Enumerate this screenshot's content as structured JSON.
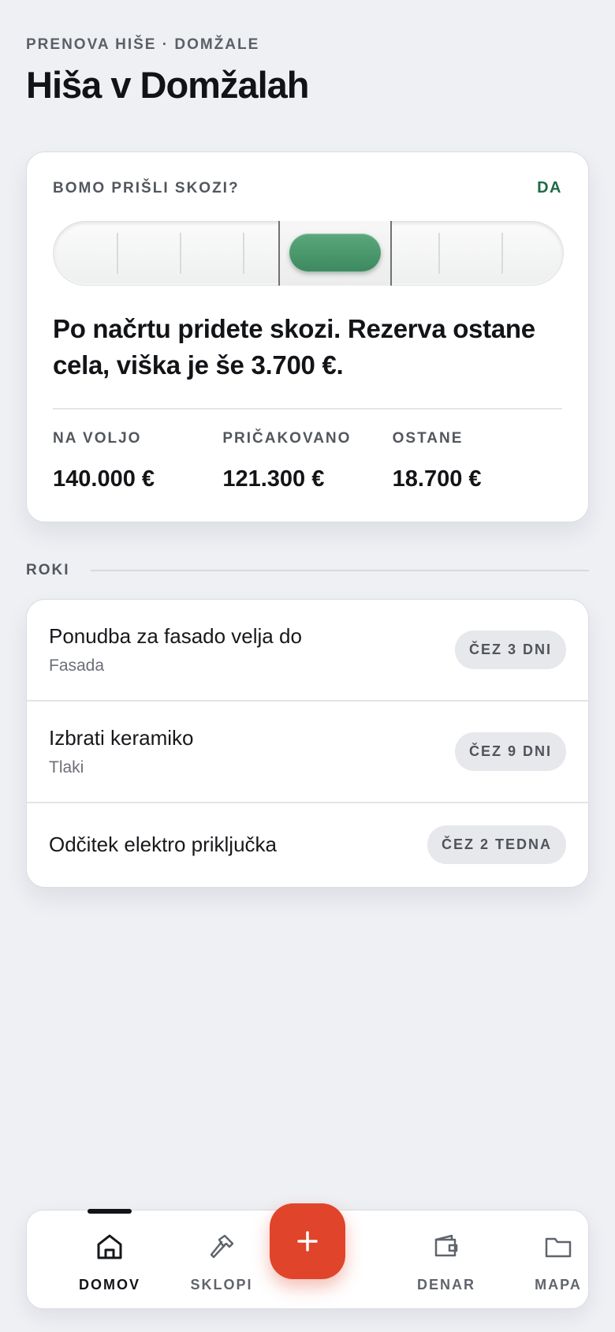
{
  "header": {
    "eyebrow": "PRENOVA HIŠE · DOMŽALE",
    "title": "Hiša v Domžalah"
  },
  "status_card": {
    "question": "BOMO PRIŠLI SKOZI?",
    "answer": "DA",
    "answer_color": "#1f6a44",
    "meter_state": "positive",
    "meter_color": "#4a9a6d",
    "verdict": "Po načrtu pridete skozi. Rezerva ostane cela, viška je še 3.700 €.",
    "stats": [
      {
        "label": "NA VOLJO",
        "value": "140.000 €"
      },
      {
        "label": "PRIČAKOVANO",
        "value": "121.300 €"
      },
      {
        "label": "OSTANE",
        "value": "18.700 €"
      }
    ]
  },
  "deadlines": {
    "section_title": "ROKI",
    "items": [
      {
        "title": "Ponudba za fasado velja do",
        "subtitle": "Fasada",
        "badge": "ČEZ 3 DNI"
      },
      {
        "title": "Izbrati keramiko",
        "subtitle": "Tlaki",
        "badge": "ČEZ 9 DNI"
      },
      {
        "title": "Odčitek elektro priključka",
        "subtitle": "",
        "badge": "ČEZ 2 TEDNA"
      }
    ]
  },
  "tabbar": {
    "tabs": [
      {
        "label": "DOMOV",
        "icon": "home-icon",
        "active": true
      },
      {
        "label": "SKLOPI",
        "icon": "hammer-icon",
        "active": false
      },
      {
        "label": "DENAR",
        "icon": "wallet-icon",
        "active": false
      },
      {
        "label": "MAPA",
        "icon": "folder-icon",
        "active": false
      }
    ],
    "fab_icon": "plus-icon",
    "fab_color": "#e0442a"
  }
}
